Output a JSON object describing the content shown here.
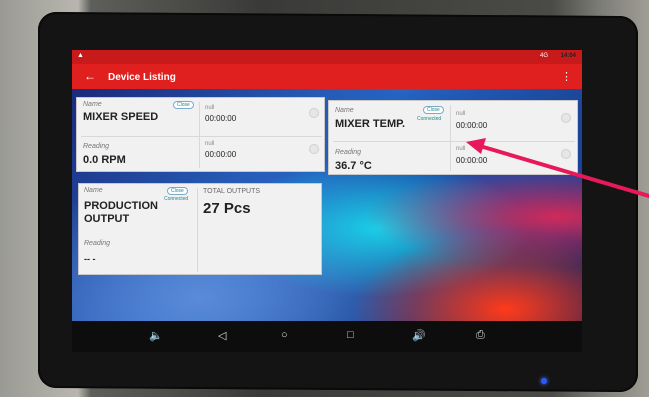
{
  "status_bar": {
    "warning_glyph": "▲",
    "signal": "4G",
    "time": "14:04"
  },
  "app_bar": {
    "back_glyph": "←",
    "title": "Device Listing",
    "menu_glyph": "⋮"
  },
  "cards": {
    "mixer_speed": {
      "name_label": "Name",
      "name": "MIXER SPEED",
      "badge": "Close",
      "reading_label": "Reading",
      "reading": "0.0 RPM",
      "slot1_label": "null",
      "slot1_value": "00:00:00",
      "slot2_label": "null",
      "slot2_value": "00:00:00"
    },
    "mixer_temp": {
      "name_label": "Name",
      "name": "MIXER TEMP.",
      "badge": "Close",
      "connected": "Connected",
      "reading_label": "Reading",
      "reading": "36.7 °C",
      "slot1_label": "null",
      "slot1_value": "00:00:00",
      "slot2_label": "null",
      "slot2_value": "00:00:00"
    },
    "production_output": {
      "name_label": "Name",
      "name_line1": "PRODUCTION",
      "name_line2": "OUTPUT",
      "badge": "Close",
      "connected": "Connected",
      "reading_label": "Reading",
      "reading": "-- -",
      "outputs_label": "TOTAL OUTPUTS",
      "outputs_value": "27 Pcs"
    }
  },
  "nav_bar": {
    "volume_down": "🔈",
    "back": "◁",
    "home": "○",
    "recents": "□",
    "volume_up": "🔊",
    "screenshot": "⎙"
  },
  "colors": {
    "accent": "#e01f1f",
    "status_bar": "#c81a1a",
    "annotation_arrow": "#e8195a"
  }
}
